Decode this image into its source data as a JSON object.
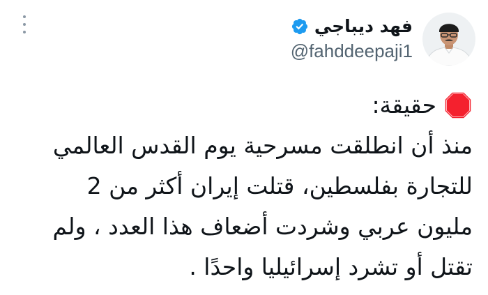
{
  "author": {
    "display_name": "فهد ديباجي",
    "handle": "@fahddeepaji1",
    "verified": true
  },
  "tweet": {
    "icon": "stop-sign-icon",
    "lines": [
      "حقيقة:",
      "منذ أن انطلقت مسرحية يوم القدس العالمي",
      "للتجارة بفلسطين، قتلت إيران أكثر من 2",
      "مليون عربي وشردت أضعاف هذا العدد ، ولم",
      "تقتل أو تشرد إسرائيليا واحدًا ."
    ]
  },
  "colors": {
    "verified_badge": "#1d9bf0",
    "stop_sign": "#f4212e",
    "handle_text": "#536471",
    "more_dots": "#8b98a5"
  }
}
